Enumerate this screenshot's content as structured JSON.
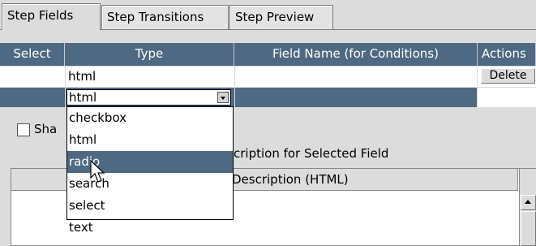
{
  "tabs": [
    "Step Fields",
    "Step Transitions",
    "Step Preview"
  ],
  "table": {
    "columns": [
      "Select",
      "Type",
      "Field Name (for Conditions)",
      "Actions"
    ],
    "rows": [
      {
        "type": "html",
        "action": "Delete"
      }
    ]
  },
  "type_select": {
    "value": "html",
    "options": [
      "checkbox",
      "html",
      "radio",
      "search",
      "select",
      "text"
    ],
    "highlighted": "radio"
  },
  "checkbox_label": "Sha",
  "section_label": "cription for Selected Field",
  "description_header": "Description (HTML)"
}
